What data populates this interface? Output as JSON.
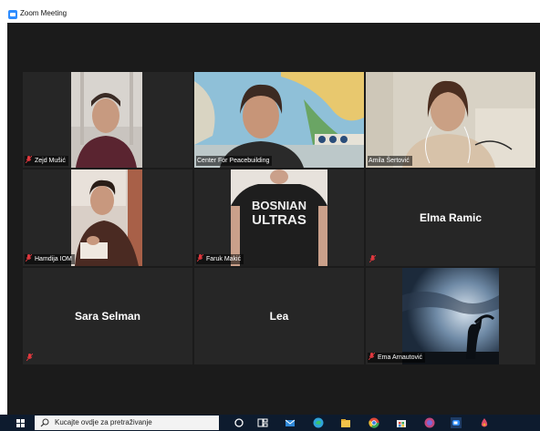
{
  "window": {
    "title": "Zoom Meeting"
  },
  "participants": [
    {
      "name": "Zejd Mušić",
      "muted": true,
      "video": true
    },
    {
      "name": "Center For Peacebuilding",
      "muted": false,
      "video": true
    },
    {
      "name": "Amila Šertović",
      "muted": false,
      "video": true,
      "active_speaker": true
    },
    {
      "name": "Hamdija IOM",
      "muted": true,
      "video": true
    },
    {
      "name": "Faruk Makić",
      "muted": true,
      "video": true
    },
    {
      "name": "Elma Ramic",
      "muted": true,
      "video": false
    },
    {
      "name": "Sara Selman",
      "muted": true,
      "video": false
    },
    {
      "name": "Lea",
      "muted": false,
      "video": false
    },
    {
      "name": "Ema Arnautović",
      "muted": true,
      "video": true
    }
  ],
  "shirt_text": {
    "line1": "BOSNIAN",
    "line2": "ULTRAS"
  },
  "taskbar": {
    "search_placeholder": "Kucajte ovdje za pretraživanje",
    "icons": [
      "windows-start-icon",
      "search-icon",
      "cortana-icon",
      "task-view-icon",
      "mail-icon",
      "edge-icon",
      "file-explorer-icon",
      "chrome-icon",
      "store-icon",
      "teams-icon",
      "zoom-icon",
      "paint-icon"
    ]
  },
  "colors": {
    "active_border": "#b8e05f",
    "mic_off": "#e0383e",
    "zoom_blue": "#2d8cff"
  }
}
